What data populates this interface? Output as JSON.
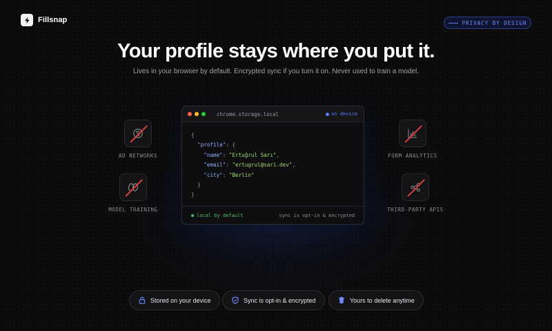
{
  "brand": {
    "name": "Fillsnap"
  },
  "badge": {
    "label": "PRIVACY BY DESIGN"
  },
  "hero": {
    "title": "Your profile stays where you put it.",
    "subtitle": "Lives in your browser by default. Encrypted sync if you turn it on. Never used to train a model."
  },
  "blocked": [
    {
      "label": "AD NETWORKS",
      "icon": "dollar-coin-icon"
    },
    {
      "label": "MODEL TRAINING",
      "icon": "infinity-loop-icon"
    },
    {
      "label": "FORM ANALYTICS",
      "icon": "bar-chart-icon"
    },
    {
      "label": "THIRD-PARTY APIS",
      "icon": "network-nodes-icon"
    }
  ],
  "code_window": {
    "filename": "chrome.storage.local",
    "status": "on device",
    "lines": {
      "open": "{",
      "profile_key": "\"profile\"",
      "profile_open": ": {",
      "name_key": "\"name\"",
      "name_value": "\"Ertuğrul Sarı\"",
      "email_key": "\"email\"",
      "email_value": "\"ertugrul@sari.dev\"",
      "city_key": "\"city\"",
      "city_value": "\"Berlin\"",
      "profile_close": "}",
      "close": "}"
    },
    "footer_left": "local by default",
    "footer_right": "sync is opt-in & encrypted"
  },
  "pills": [
    {
      "label": "Stored on your device",
      "icon": "lock-icon"
    },
    {
      "label": "Sync is opt-in & encrypted",
      "icon": "shield-icon"
    },
    {
      "label": "Yours to delete anytime",
      "icon": "trash-icon"
    }
  ],
  "colors": {
    "background": "#0b0b0c",
    "accent": "#5b7cff",
    "success": "#3fbf5f",
    "blocked_slash": "#d94040",
    "code_key": "#8fb0ff",
    "code_string": "#a8d970"
  }
}
